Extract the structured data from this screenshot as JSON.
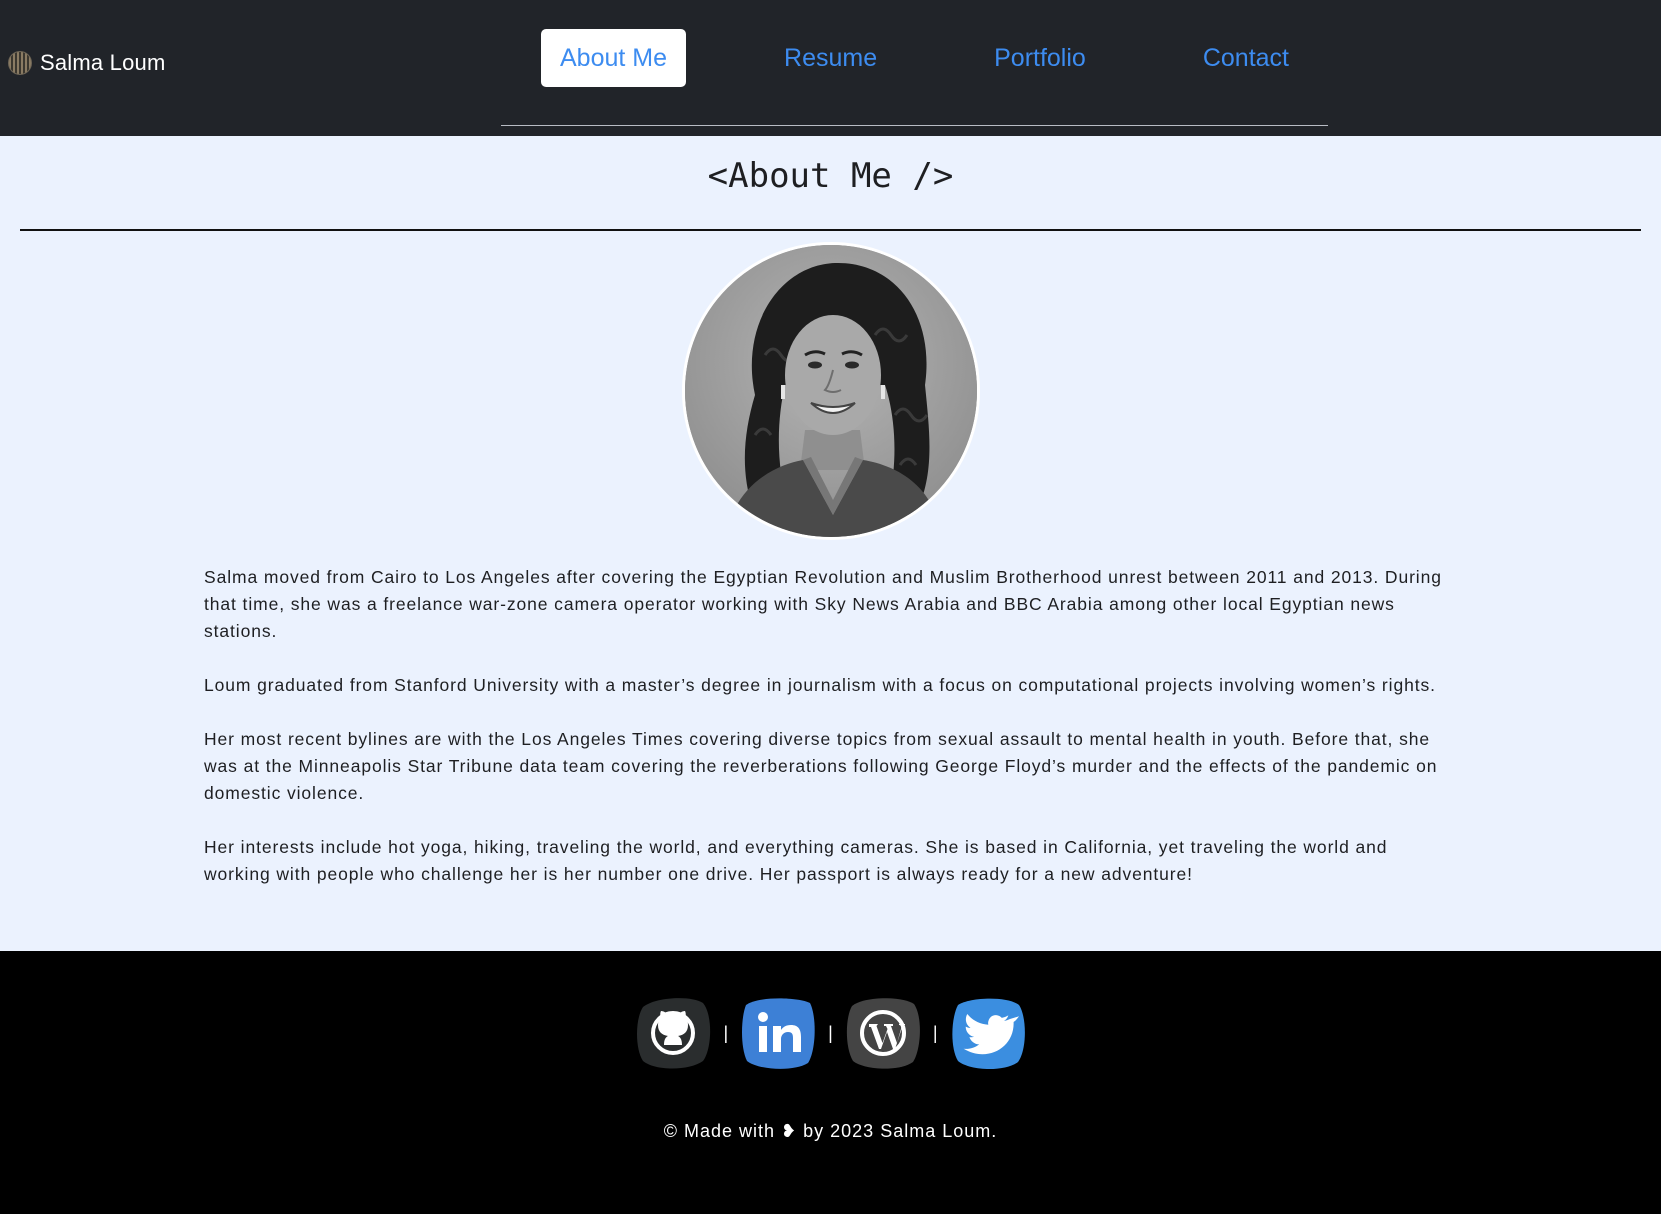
{
  "brand": {
    "name": "Salma Loum",
    "logo_icon": "striped-circle-logo"
  },
  "nav": {
    "items": [
      {
        "label": "About Me",
        "active": true
      },
      {
        "label": "Resume",
        "active": false
      },
      {
        "label": "Portfolio",
        "active": false
      },
      {
        "label": "Contact",
        "active": false
      }
    ]
  },
  "main": {
    "title": "<About Me />",
    "avatar_icon": "profile-photo",
    "paragraphs": [
      "Salma moved from Cairo to Los Angeles after covering the Egyptian Revolution and Muslim Brotherhood unrest between 2011 and 2013. During that time, she was a freelance war-zone camera operator working with Sky News Arabia and BBC Arabia among other local Egyptian news stations.",
      "Loum graduated from Stanford University with a master’s degree in journalism with a focus on computational projects involving women’s rights.",
      "Her most recent bylines are with the Los Angeles Times covering diverse topics from sexual assault to mental health in youth. Before that, she was at the Minneapolis Star Tribune data team covering the reverberations following George Floyd’s murder and the effects of the pandemic on domestic violence.",
      "Her interests include hot yoga, hiking, traveling the world, and everything cameras. She is based in California, yet traveling the world and working with people who challenge her is her number one drive. Her passport is always ready for a new adventure!"
    ]
  },
  "footer": {
    "social": [
      {
        "name": "github-icon",
        "color": "#2a2d2e"
      },
      {
        "name": "linkedin-icon",
        "color": "#3d80d6"
      },
      {
        "name": "wordpress-icon",
        "color": "#444444"
      },
      {
        "name": "twitter-icon",
        "color": "#3b8ee0"
      }
    ],
    "separator": "|",
    "copyright": "© Made with ❥ by 2023 Salma Loum."
  },
  "colors": {
    "nav_bg": "#212429",
    "nav_link": "#3d8cf0",
    "page_bg": "#ebf2fe",
    "footer_bg": "#000000"
  }
}
